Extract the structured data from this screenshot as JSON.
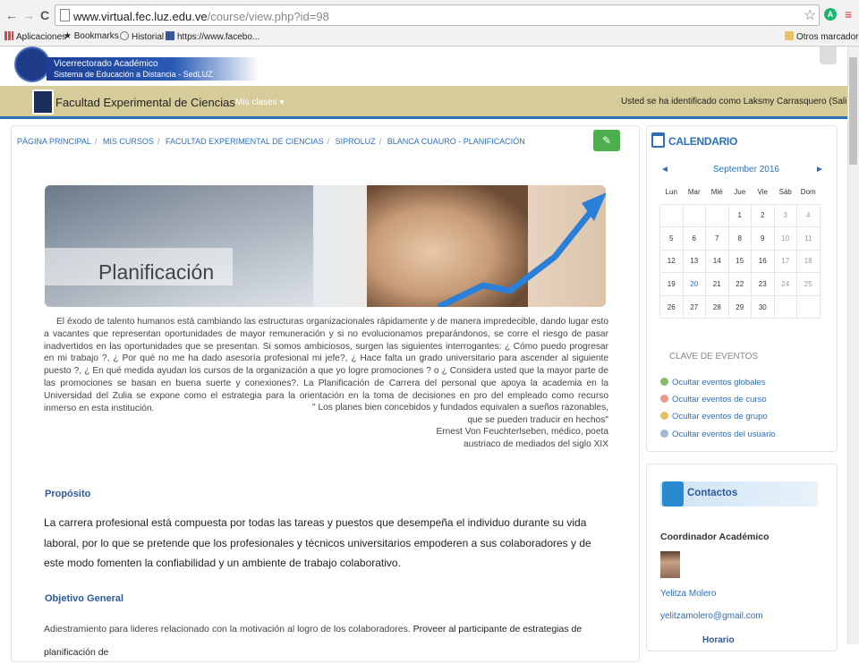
{
  "browser": {
    "url_host": "www.virtual.fec.luz.edu.ve",
    "url_path": "/course/view.php?id=98",
    "back": "←",
    "forward": "→",
    "reload": "C",
    "star": "☆",
    "ext": "A",
    "menu": "≡",
    "bookmarks": [
      "Aplicaciones",
      "Bookmarks",
      "Historial",
      "https://www.facebo..."
    ],
    "other_bookmarks": "Otros marcadores"
  },
  "site": {
    "banner_line1": "Vicerrectorado Académico",
    "banner_line2": "Sistema de Educación a Distancia - SedLUZ",
    "faculty": "Facultad Experimental de Ciencias",
    "mis_clases": "Mis clases ▾",
    "logged_in": "Usted se ha identificado como Laksmy Carrasquero (Salir)"
  },
  "breadcrumb": [
    "PÁGINA PRINCIPAL",
    "MIS CURSOS",
    "FACULTAD EXPERIMENTAL DE CIENCIAS",
    "SIPROLUZ",
    "BLANCA CUAURO - PLANIFICACIÓN"
  ],
  "breadcrumb_sep": "/",
  "edit_icon": "✎",
  "hero_title": "Planificación",
  "intro": "El éxodo de talento humanos está cambiando las estructuras organizacionales rápidamente y de manera impredecible, dando lugar esto a vacantes que representan oportunidades de mayor remuneración y si no evolucionamos preparándonos, se corre el riesgo de pasar inadvertidos en las oportunidades que se presentan. Si somos ambiciosos, surgen las siguientes interrogantes: ¿ Cómo puedo progresar en mi trabajo ?, ¿ Por qué no me ha dado asesoría profesional mi jefe?, ¿ Hace falta un grado universitario para ascender al siguiente puesto ?, ¿ En qué medida ayudan los cursos de la organización a que yo logre promociones ? o ¿ Considera usted que la mayor parte de las promociones se basan en buena suerte y conexiones?. La Planificación de Carrera del personal que apoya la academia en la Universidad del Zulia se expone como el estrategia para la orientación en la toma de decisiones en pro del empleado como recurso inmerso en esta institución.",
  "quote": [
    "\" Los planes bien concebidos y fundados equivalen a sueños razonables,",
    "que se pueden traducir en hechos\"",
    "Ernest Von Feuchterlseben, médico, poeta",
    "austriaco de mediados del siglo XIX"
  ],
  "proposito_h": "Propósito",
  "proposito": "La carrera profesional está compuesta por todas las tareas y puestos que desempeña el individuo durante su vida laboral, por lo que se pretende que los profesionales y técnicos universitarios empoderen a sus colaboradores y de este modo fomenten la confiabilidad y un ambiente de trabajo colaborativo.",
  "objetivo_h": "Objetivo General",
  "objetivo_a": "Adiestramiento para lideres relacionado con la motivación al logro de los colaboradores.",
  "objetivo_b": " Proveer al participante de estrategias de planificación de",
  "calendar": {
    "title": "CALENDARIO",
    "month": "September 2016",
    "prev": "◄",
    "next": "►",
    "days": [
      "Lun",
      "Mar",
      "Mié",
      "Jue",
      "Vie",
      "Sáb",
      "Dom"
    ],
    "weeks": [
      [
        "",
        "",
        "",
        "1",
        "2",
        "3",
        "4"
      ],
      [
        "5",
        "6",
        "7",
        "8",
        "9",
        "10",
        "11"
      ],
      [
        "12",
        "13",
        "14",
        "15",
        "16",
        "17",
        "18"
      ],
      [
        "19",
        "20",
        "21",
        "22",
        "23",
        "24",
        "25"
      ],
      [
        "26",
        "27",
        "28",
        "29",
        "30",
        "",
        ""
      ]
    ],
    "today": "20"
  },
  "clave": {
    "title": "CLAVE DE EVENTOS",
    "items": [
      "Ocultar eventos globales",
      "Ocultar eventos de curso",
      "Ocultar eventos de grupo",
      "Ocultar eventos del usuario"
    ],
    "colors": [
      "#8ab86a",
      "#e89a8a",
      "#e0c060",
      "#a0b8d0"
    ]
  },
  "contactos": {
    "title": "Contactos",
    "role": "Coordinador Académico",
    "name": "Yelitza Molero",
    "email": "yelitzamolero@gmail.com",
    "horario": "Horario"
  }
}
